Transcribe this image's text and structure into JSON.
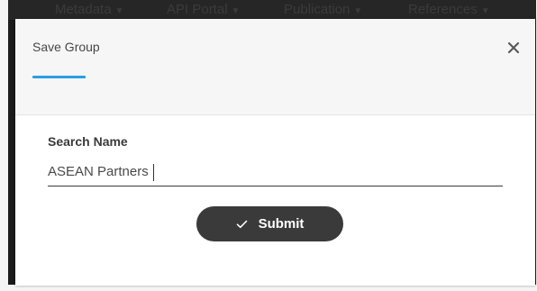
{
  "background_nav": {
    "items": [
      "Metadata",
      "API Portal",
      "Publication",
      "References"
    ]
  },
  "modal": {
    "title": "Save Group",
    "close_icon": "close-icon",
    "field_label": "Search Name",
    "field_value": "ASEAN Partners",
    "submit_label": "Submit",
    "submit_icon": "check-icon",
    "accent_color": "#2a9fe0",
    "button_color": "#3a3a3a"
  }
}
